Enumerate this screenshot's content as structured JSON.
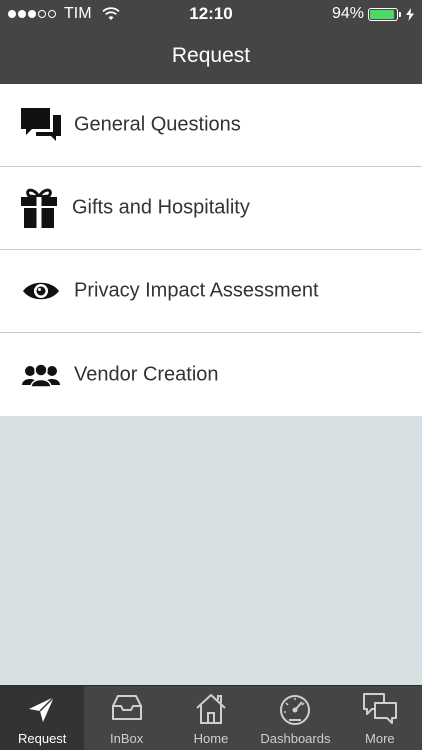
{
  "status_bar": {
    "carrier": "TIM",
    "time": "12:10",
    "battery_percent": "94%",
    "battery_level": 0.94,
    "signal_bars_filled": 3,
    "signal_bars_total": 5
  },
  "nav": {
    "title": "Request"
  },
  "list": {
    "items": [
      {
        "label": "General Questions",
        "icon": "chat-bubbles-icon"
      },
      {
        "label": "Gifts and Hospitality",
        "icon": "gift-icon"
      },
      {
        "label": "Privacy Impact Assessment",
        "icon": "eye-icon"
      },
      {
        "label": "Vendor Creation",
        "icon": "group-icon"
      }
    ]
  },
  "tabbar": {
    "tabs": [
      {
        "label": "Request",
        "icon": "paper-plane-icon",
        "active": true
      },
      {
        "label": "InBox",
        "icon": "inbox-tray-icon",
        "active": false
      },
      {
        "label": "Home",
        "icon": "home-icon",
        "active": false
      },
      {
        "label": "Dashboards",
        "icon": "gauge-icon",
        "active": false
      },
      {
        "label": "More",
        "icon": "chat-bubbles-outline-icon",
        "active": false
      }
    ]
  },
  "colors": {
    "bar_background": "#454545",
    "active_tab_background": "#333333",
    "content_background": "#d8dfe3",
    "battery_fill": "#4cd964"
  }
}
